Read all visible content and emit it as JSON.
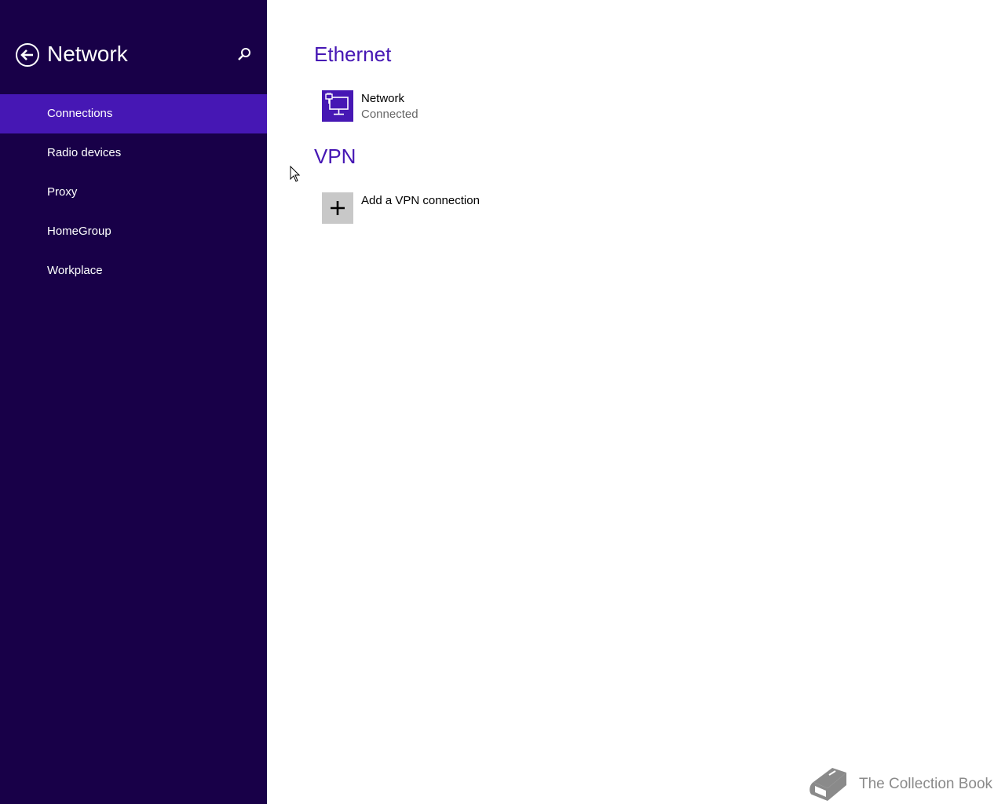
{
  "sidebar": {
    "title": "Network",
    "back_icon": "back-arrow-circle-icon",
    "search_icon": "search-icon",
    "items": [
      {
        "label": "Connections",
        "selected": true
      },
      {
        "label": "Radio devices",
        "selected": false
      },
      {
        "label": "Proxy",
        "selected": false
      },
      {
        "label": "HomeGroup",
        "selected": false
      },
      {
        "label": "Workplace",
        "selected": false
      }
    ]
  },
  "main": {
    "ethernet": {
      "title": "Ethernet",
      "connection": {
        "icon": "ethernet-network-icon",
        "name": "Network",
        "status": "Connected"
      }
    },
    "vpn": {
      "title": "VPN",
      "add": {
        "icon": "plus-icon",
        "label": "Add a VPN connection"
      }
    }
  },
  "watermark": {
    "icon": "book-icon",
    "text": "The Collection Book"
  },
  "colors": {
    "sidebar_bg": "#180048",
    "accent": "#4617b4",
    "tile_gray": "#c8c8c8",
    "secondary_text": "#666666"
  }
}
